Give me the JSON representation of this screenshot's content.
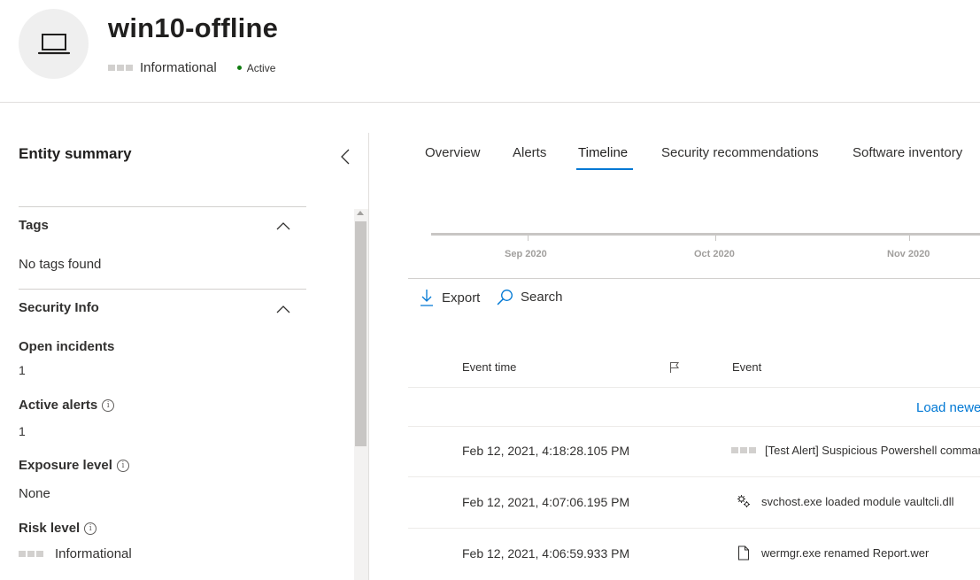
{
  "header": {
    "device_name": "win10-offline",
    "severity": "Informational",
    "status": "Active",
    "status_color": "#107c10"
  },
  "left_panel": {
    "title": "Entity summary",
    "tags": {
      "heading": "Tags",
      "empty_text": "No tags found"
    },
    "security_info": {
      "heading": "Security Info",
      "open_incidents": {
        "label": "Open incidents",
        "value": "1"
      },
      "active_alerts": {
        "label": "Active alerts",
        "value": "1"
      },
      "exposure_level": {
        "label": "Exposure level",
        "value": "None"
      },
      "risk_level": {
        "label": "Risk level",
        "value": "Informational"
      }
    }
  },
  "tabs": [
    {
      "label": "Overview"
    },
    {
      "label": "Alerts"
    },
    {
      "label": "Timeline",
      "active": true
    },
    {
      "label": "Security recommendations"
    },
    {
      "label": "Software inventory"
    }
  ],
  "timeline": {
    "months": [
      "Sep 2020",
      "Oct 2020",
      "Nov 2020"
    ]
  },
  "toolbar": {
    "export_label": "Export",
    "search_label": "Search"
  },
  "table": {
    "columns": {
      "event_time": "Event time",
      "event": "Event"
    },
    "load_newer": "Load newe",
    "rows": [
      {
        "time": "Feb 12, 2021, 4:18:28.105 PM",
        "event": "[Test Alert] Suspicious Powershell commar",
        "icon": "severity-bars-icon"
      },
      {
        "time": "Feb 12, 2021, 4:07:06.195 PM",
        "event": "svchost.exe loaded module vaultcli.dll",
        "icon": "gears-icon"
      },
      {
        "time": "Feb 12, 2021, 4:06:59.933 PM",
        "event": "wermgr.exe renamed Report.wer",
        "icon": "document-icon"
      }
    ]
  },
  "colors": {
    "accent": "#0078d4",
    "text": "#201f1e",
    "muted": "#a19f9d"
  }
}
